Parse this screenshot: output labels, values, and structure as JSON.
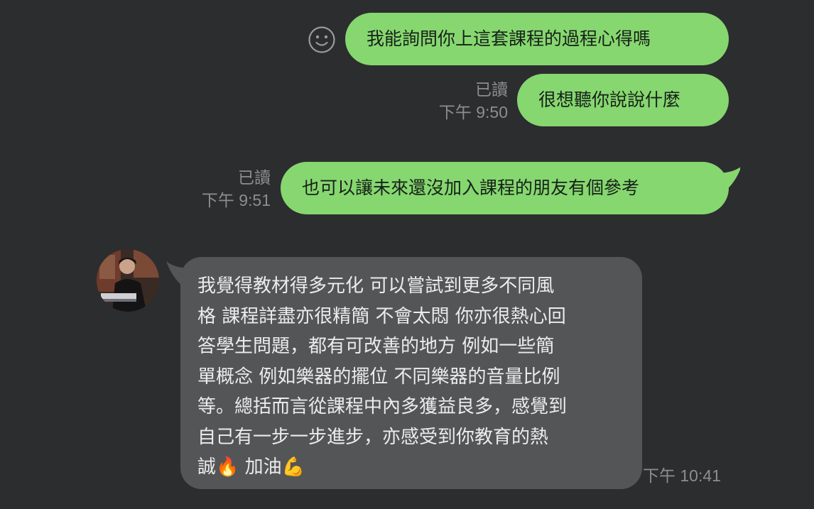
{
  "messages": {
    "outgoing": [
      {
        "text": "我能詢問你上這套課程的過程心得嗎"
      },
      {
        "text": "很想聽你說說什麼",
        "read": "已讀",
        "time": "下午 9:50"
      },
      {
        "text": "也可以讓未來還沒加入課程的朋友有個參考",
        "read": "已讀",
        "time": "下午 9:51"
      }
    ],
    "incoming": {
      "lines": [
        "我覺得教材得多元化 可以嘗試到更多不同風",
        "格 課程詳盡亦很精簡 不會太悶 你亦很熱心回",
        "答學生問題，都有可改善的地方 例如一些簡",
        "單概念 例如樂器的擺位 不同樂器的音量比例",
        "等。總括而言從課程中內多獲益良多，感覺到",
        "自己有一步一步進步，亦感受到你教育的熱",
        "誠🔥 加油💪"
      ],
      "time": "下午 10:41"
    }
  },
  "icons": {
    "sticker": "smiley-icon",
    "avatar": "user-avatar"
  },
  "colors": {
    "background": "#2c2d2f",
    "outgoing_bubble": "#86d76f",
    "incoming_bubble": "#545557",
    "meta_text": "#8c8d8f"
  }
}
